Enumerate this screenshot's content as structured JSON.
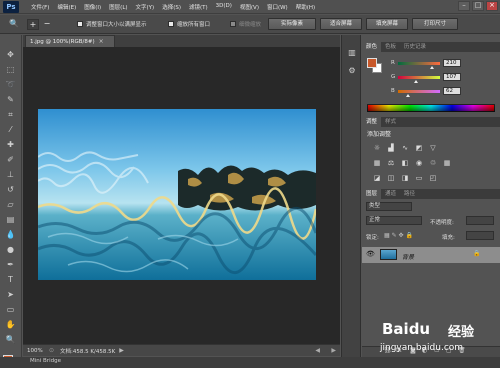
{
  "app": {
    "logo": "Ps",
    "menu": [
      "文件(F)",
      "编辑(E)",
      "图像(I)",
      "图层(L)",
      "文字(Y)",
      "选择(S)",
      "滤镜(T)",
      "3D(D)",
      "视图(V)",
      "窗口(W)",
      "帮助(H)"
    ],
    "window_controls": [
      "–",
      "□",
      "×"
    ]
  },
  "options_bar": {
    "zoom_in": "+",
    "zoom_out": "−",
    "resize_windows_label": "调整窗口大小以满屏显示",
    "zoom_all_label": "缩放所有窗口",
    "scrubby_zoom_label": "细微缩放",
    "buttons": [
      "实际像素",
      "适合屏幕",
      "填充屏幕",
      "打印尺寸"
    ]
  },
  "document": {
    "tab_title": "1.jpg @ 100%(RGB/8#)",
    "tab_close": "×",
    "zoom": "100%",
    "doc_size": "文档:458.5 K/458.5K"
  },
  "status": {
    "mini_bridge": "Mini Bridge"
  },
  "color_panel": {
    "tabs": [
      "颜色",
      "色板",
      "历史记录"
    ],
    "fg_color": "#c8582a",
    "bg_color": "#ffffff",
    "sliders": [
      {
        "label": "R",
        "value": "210",
        "fraction": 0.82
      },
      {
        "label": "G",
        "value": "107",
        "fraction": 0.42
      },
      {
        "label": "B",
        "value": "62",
        "fraction": 0.24
      }
    ]
  },
  "adjustments_panel": {
    "tabs": [
      "调整",
      "样式"
    ],
    "title": "添加调整"
  },
  "layers_panel": {
    "tabs": [
      "图层",
      "通道",
      "路径"
    ],
    "kind": "类型",
    "blend_mode": "正常",
    "opacity_label": "不透明度:",
    "lock_label": "锁定:",
    "fill_label": "填充:",
    "layer": {
      "name": "背景"
    }
  },
  "watermark": {
    "brand": "Baidu",
    "brand_cn": "经验",
    "url": "jingyan.baidu.com"
  }
}
